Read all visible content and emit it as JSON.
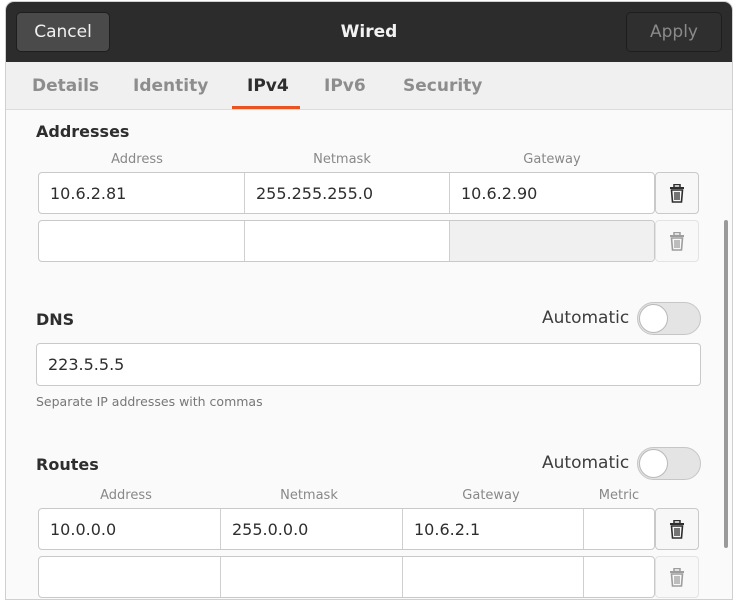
{
  "header": {
    "cancel_label": "Cancel",
    "title": "Wired",
    "apply_label": "Apply"
  },
  "tabs": [
    {
      "label": "Details"
    },
    {
      "label": "Identity"
    },
    {
      "label": "IPv4",
      "active": true
    },
    {
      "label": "IPv6"
    },
    {
      "label": "Security"
    }
  ],
  "addresses": {
    "title": "Addresses",
    "headers": {
      "address": "Address",
      "netmask": "Netmask",
      "gateway": "Gateway"
    },
    "rows": [
      {
        "address": "10.6.2.81",
        "netmask": "255.255.255.0",
        "gateway": "10.6.2.90"
      },
      {
        "address": "",
        "netmask": "",
        "gateway": ""
      }
    ]
  },
  "dns": {
    "title": "DNS",
    "automatic_label": "Automatic",
    "automatic_on": false,
    "value": "223.5.5.5",
    "hint": "Separate IP addresses with commas"
  },
  "routes": {
    "title": "Routes",
    "automatic_label": "Automatic",
    "automatic_on": false,
    "headers": {
      "address": "Address",
      "netmask": "Netmask",
      "gateway": "Gateway",
      "metric": "Metric"
    },
    "rows": [
      {
        "address": "10.0.0.0",
        "netmask": "255.0.0.0",
        "gateway": "10.6.2.1",
        "metric": ""
      },
      {
        "address": "",
        "netmask": "",
        "gateway": "",
        "metric": ""
      }
    ]
  },
  "icons": {
    "delete": "trash-icon"
  },
  "colors": {
    "accent": "#e95420",
    "headerbar": "#2c2c2c"
  }
}
